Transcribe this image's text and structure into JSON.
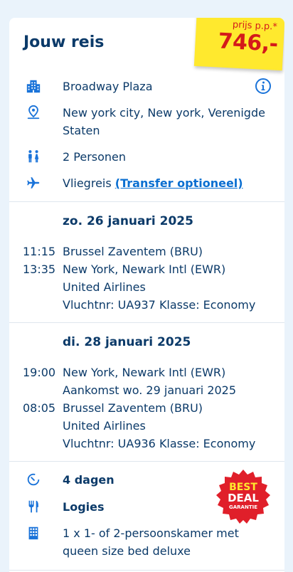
{
  "title": "Jouw reis",
  "price": {
    "label": "prijs p.p.*",
    "amount": "746,-"
  },
  "hotel": "Broadway Plaza",
  "location": "New york city, New york, Verenigde Staten",
  "location_lines": [
    "New york city, New york, Verenigde",
    "Staten"
  ],
  "persons": "2 Personen",
  "travel": {
    "prefix": "Vliegreis",
    "link": "(Transfer optioneel)"
  },
  "outbound": {
    "date": "zo. 26 januari 2025",
    "dep_time": "11:15",
    "dep_place": "Brussel Zaventem (BRU)",
    "arr_time": "13:35",
    "arr_place": "New York, Newark Intl (EWR)",
    "airline": "United Airlines",
    "flight": "Vluchtnr: UA937 Klasse: Economy"
  },
  "return": {
    "date": "di. 28 januari 2025",
    "dep_time": "19:00",
    "dep_place": "New York, Newark Intl (EWR)",
    "arrival_note": "Aankomst wo. 29 januari 2025",
    "arr_time": "08:05",
    "arr_place": "Brussel Zaventem (BRU)",
    "airline": "United Airlines",
    "flight": "Vluchtnr: UA936 Klasse: Economy"
  },
  "duration": "4 dagen",
  "board": "Logies",
  "room_lines": [
    "1 x 1- of 2-persoonskamer met",
    "queen size bed deluxe"
  ],
  "badge": {
    "line1": "BEST",
    "line2": "DEAL",
    "line3": "GARANTIE"
  },
  "colors": {
    "navy": "#0b3a69",
    "blue": "#1a73d9",
    "yellow": "#ffe92e",
    "red": "#d41a1a"
  },
  "icons": [
    "hotel-icon",
    "location-pin-icon",
    "persons-icon",
    "airplane-icon",
    "info-icon",
    "timer-icon",
    "cutlery-icon",
    "room-icon"
  ]
}
